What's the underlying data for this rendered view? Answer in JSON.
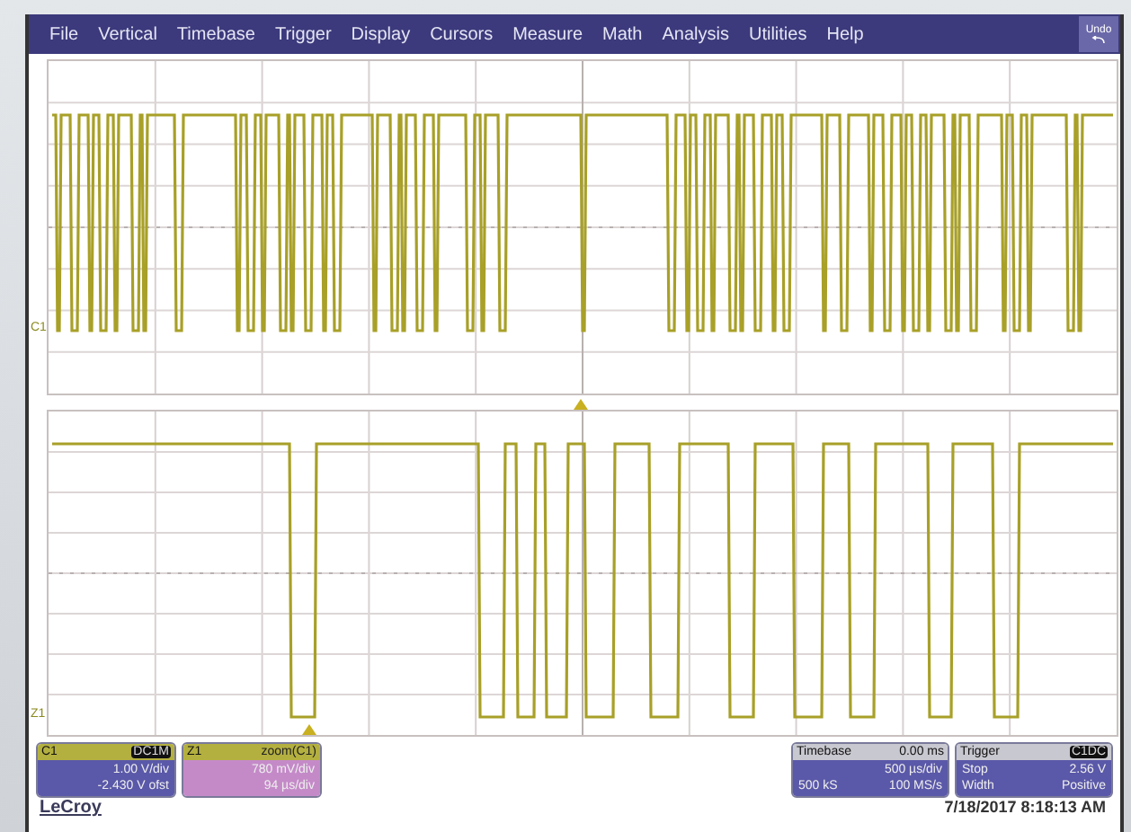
{
  "menu": {
    "items": [
      {
        "label": "File"
      },
      {
        "label": "Vertical"
      },
      {
        "label": "Timebase"
      },
      {
        "label": "Trigger"
      },
      {
        "label": "Display"
      },
      {
        "label": "Cursors"
      },
      {
        "label": "Measure"
      },
      {
        "label": "Math"
      },
      {
        "label": "Analysis"
      },
      {
        "label": "Utilities"
      },
      {
        "label": "Help"
      }
    ],
    "undo": "Undo"
  },
  "grids": [
    {
      "trace_label": "C1"
    },
    {
      "trace_label": "Z1"
    }
  ],
  "left_panels": [
    {
      "kind": "channel",
      "name": "C1",
      "badge": "DC1M",
      "lines": [
        "1.00 V/div",
        "-2.430 V ofst"
      ]
    },
    {
      "kind": "zoom",
      "name": "Z1",
      "badge": "zoom(C1)",
      "lines": [
        "780 mV/div",
        "94 µs/div"
      ]
    }
  ],
  "timebase": {
    "title": "Timebase",
    "delay": "0.00 ms",
    "rows": [
      [
        "",
        "500 µs/div"
      ],
      [
        "500 kS",
        "100 MS/s"
      ]
    ]
  },
  "trigger": {
    "title": "Trigger",
    "badge": "C1DC",
    "rows": [
      [
        "Stop",
        "2.56 V"
      ],
      [
        "Width",
        "Positive"
      ]
    ]
  },
  "brand": "LeCroy",
  "timestamp": "7/18/2017 8:18:13 AM"
}
